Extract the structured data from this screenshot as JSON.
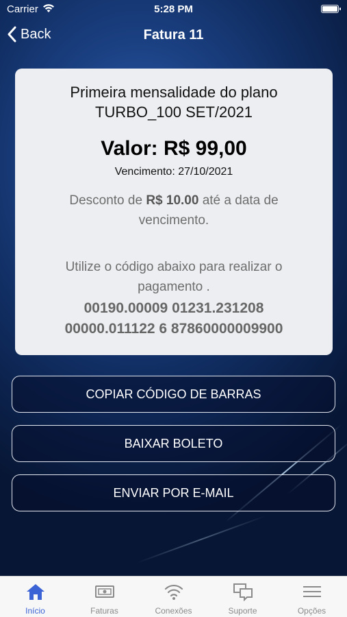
{
  "status_bar": {
    "carrier": "Carrier",
    "time": "5:28 PM"
  },
  "nav": {
    "back_label": "Back",
    "title": "Fatura 11"
  },
  "invoice": {
    "description": "Primeira mensalidade do plano TURBO_100 SET/2021",
    "valor": "Valor: R$ 99,00",
    "vencimento": "Vencimento: 27/10/2021",
    "desconto_prefix": "Desconto de ",
    "desconto_amount": "R$ 10.00",
    "desconto_suffix": " até a data de vencimento.",
    "instruction": "Utilize o código abaixo para realizar o pagamento .",
    "barcode_line1": "00190.00009 01231.231208",
    "barcode_line2": "00000.011122 6 87860000009900"
  },
  "actions": {
    "copy_barcode": "COPIAR CÓDIGO DE BARRAS",
    "download_boleto": "BAIXAR BOLETO",
    "send_email": "ENVIAR POR E-MAIL"
  },
  "tabbar": {
    "items": [
      {
        "label": "Início",
        "icon": "home-icon",
        "active": true
      },
      {
        "label": "Faturas",
        "icon": "invoice-icon",
        "active": false
      },
      {
        "label": "Conexões",
        "icon": "wifi-icon",
        "active": false
      },
      {
        "label": "Suporte",
        "icon": "chat-icon",
        "active": false
      },
      {
        "label": "Opções",
        "icon": "menu-icon",
        "active": false
      }
    ]
  },
  "colors": {
    "accent": "#3b63d6",
    "card_bg": "#eceef1",
    "background": "#1a3f80"
  }
}
